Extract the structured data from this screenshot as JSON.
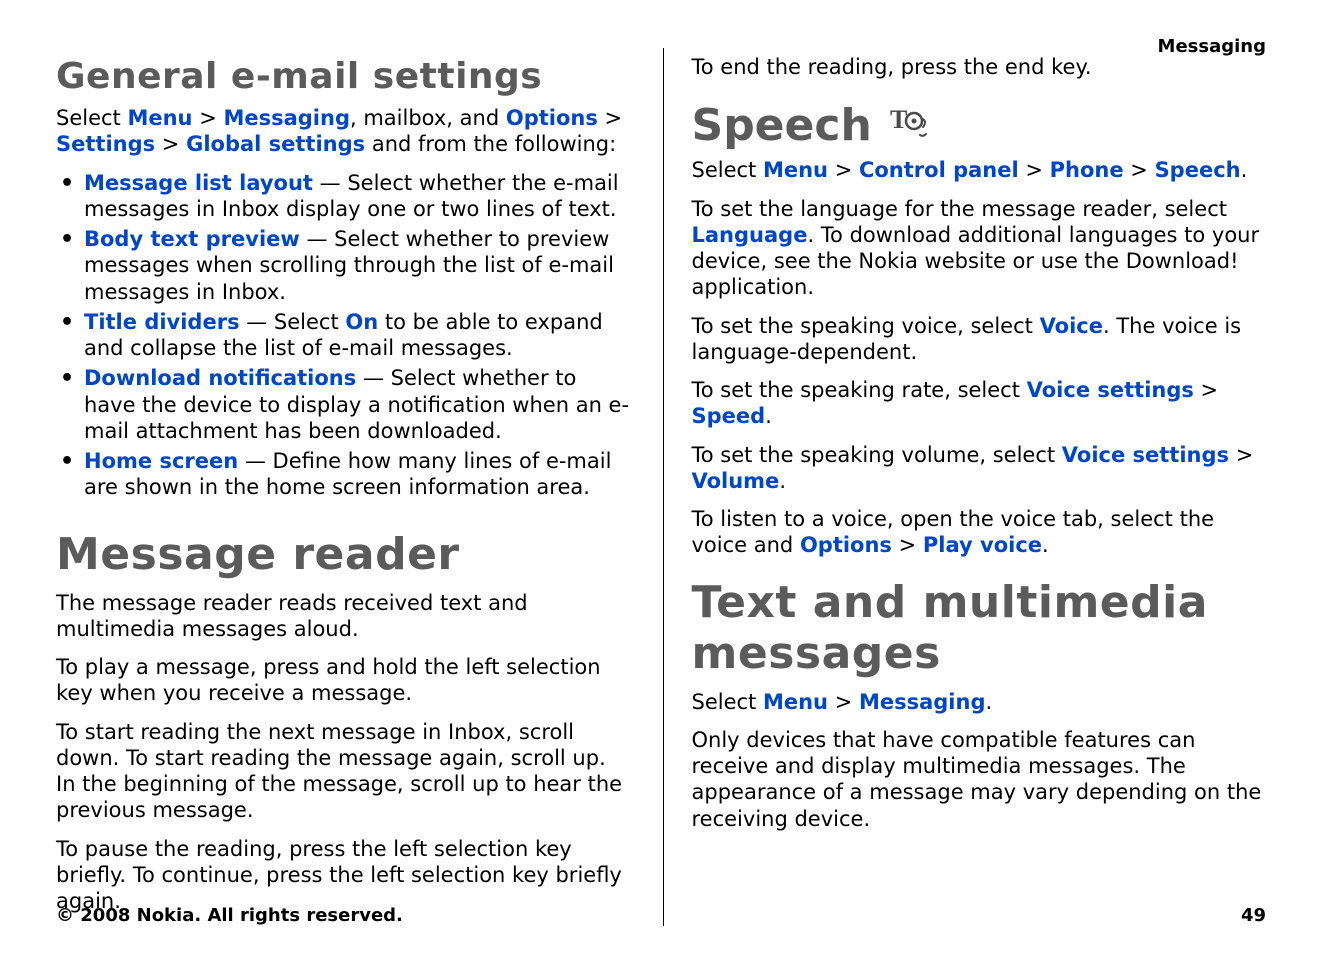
{
  "running_head": "Messaging",
  "footer": {
    "copyright": "© 2008 Nokia. All rights reserved.",
    "page_number": "49"
  },
  "left": {
    "heading_general": "General e-mail settings",
    "intro": {
      "pre": "Select ",
      "menu": "Menu",
      "chev1": " > ",
      "messaging": "Messaging",
      "mid1": ", mailbox, and ",
      "options": "Options",
      "chev2": " > ",
      "settings": "Settings",
      "chev3": " > ",
      "global": "Global settings",
      "tail": " and from the following:"
    },
    "bullets": [
      {
        "key": "Message list layout",
        "rest": " — Select whether the e-mail messages in Inbox display one or two lines of text."
      },
      {
        "key": "Body text preview",
        "rest": " — Select whether to preview messages when scrolling through the list of e-mail messages in Inbox."
      },
      {
        "key": "Title dividers",
        "rest_pre": " — Select ",
        "on": "On",
        "rest_post": " to be able to expand and collapse the list of e-mail messages."
      },
      {
        "key": "Download notifications",
        "rest": " — Select whether to have the device to display a notification when an e-mail attachment has been downloaded."
      },
      {
        "key": "Home screen",
        "rest": " — Define how many lines of e-mail are shown in the home screen information area."
      }
    ],
    "heading_reader": "Message reader",
    "reader_p1": "The message reader reads received text and multimedia messages aloud.",
    "reader_p2": "To play a message, press and hold the left selection key when you receive a message.",
    "reader_p3": "To start reading the next message in Inbox, scroll down. To start reading the message again, scroll up. In the beginning of the message, scroll up to hear the previous message.",
    "reader_p4": "To pause the reading, press the left selection key briefly. To continue, press the left selection key briefly again."
  },
  "right": {
    "reader_end": "To end the reading, press the end key.",
    "heading_speech": "Speech",
    "speech_nav": {
      "pre": "Select ",
      "menu": "Menu",
      "chev1": " > ",
      "cp": "Control panel",
      "chev2": " > ",
      "phone": "Phone",
      "chev3": " > ",
      "speech": "Speech",
      "tail": "."
    },
    "speech_lang": {
      "pre": "To set the language for the message reader, select ",
      "language": "Language",
      "post": ". To download additional languages to your device, see the Nokia website or use the Download! application."
    },
    "speech_voice": {
      "pre": "To set the speaking voice, select ",
      "voice": "Voice",
      "post": ". The voice is language-dependent."
    },
    "speech_rate": {
      "pre": "To set the speaking rate, select ",
      "vs": "Voice settings",
      "chev": " > ",
      "speed": "Speed",
      "tail": "."
    },
    "speech_volume": {
      "pre": "To set the speaking volume, select ",
      "vs": "Voice settings",
      "chev": " > ",
      "volume": "Volume",
      "tail": "."
    },
    "speech_listen": {
      "pre": "To listen to a voice, open the voice tab, select the voice and ",
      "options": "Options",
      "chev": " > ",
      "play": "Play voice",
      "tail": "."
    },
    "heading_textmm": "Text and multimedia messages",
    "textmm_nav": {
      "pre": "Select ",
      "menu": "Menu",
      "chev": " > ",
      "messaging": "Messaging",
      "tail": "."
    },
    "textmm_p": "Only devices that have compatible features can receive and display multimedia messages. The appearance of a message may vary depending on the receiving device."
  }
}
